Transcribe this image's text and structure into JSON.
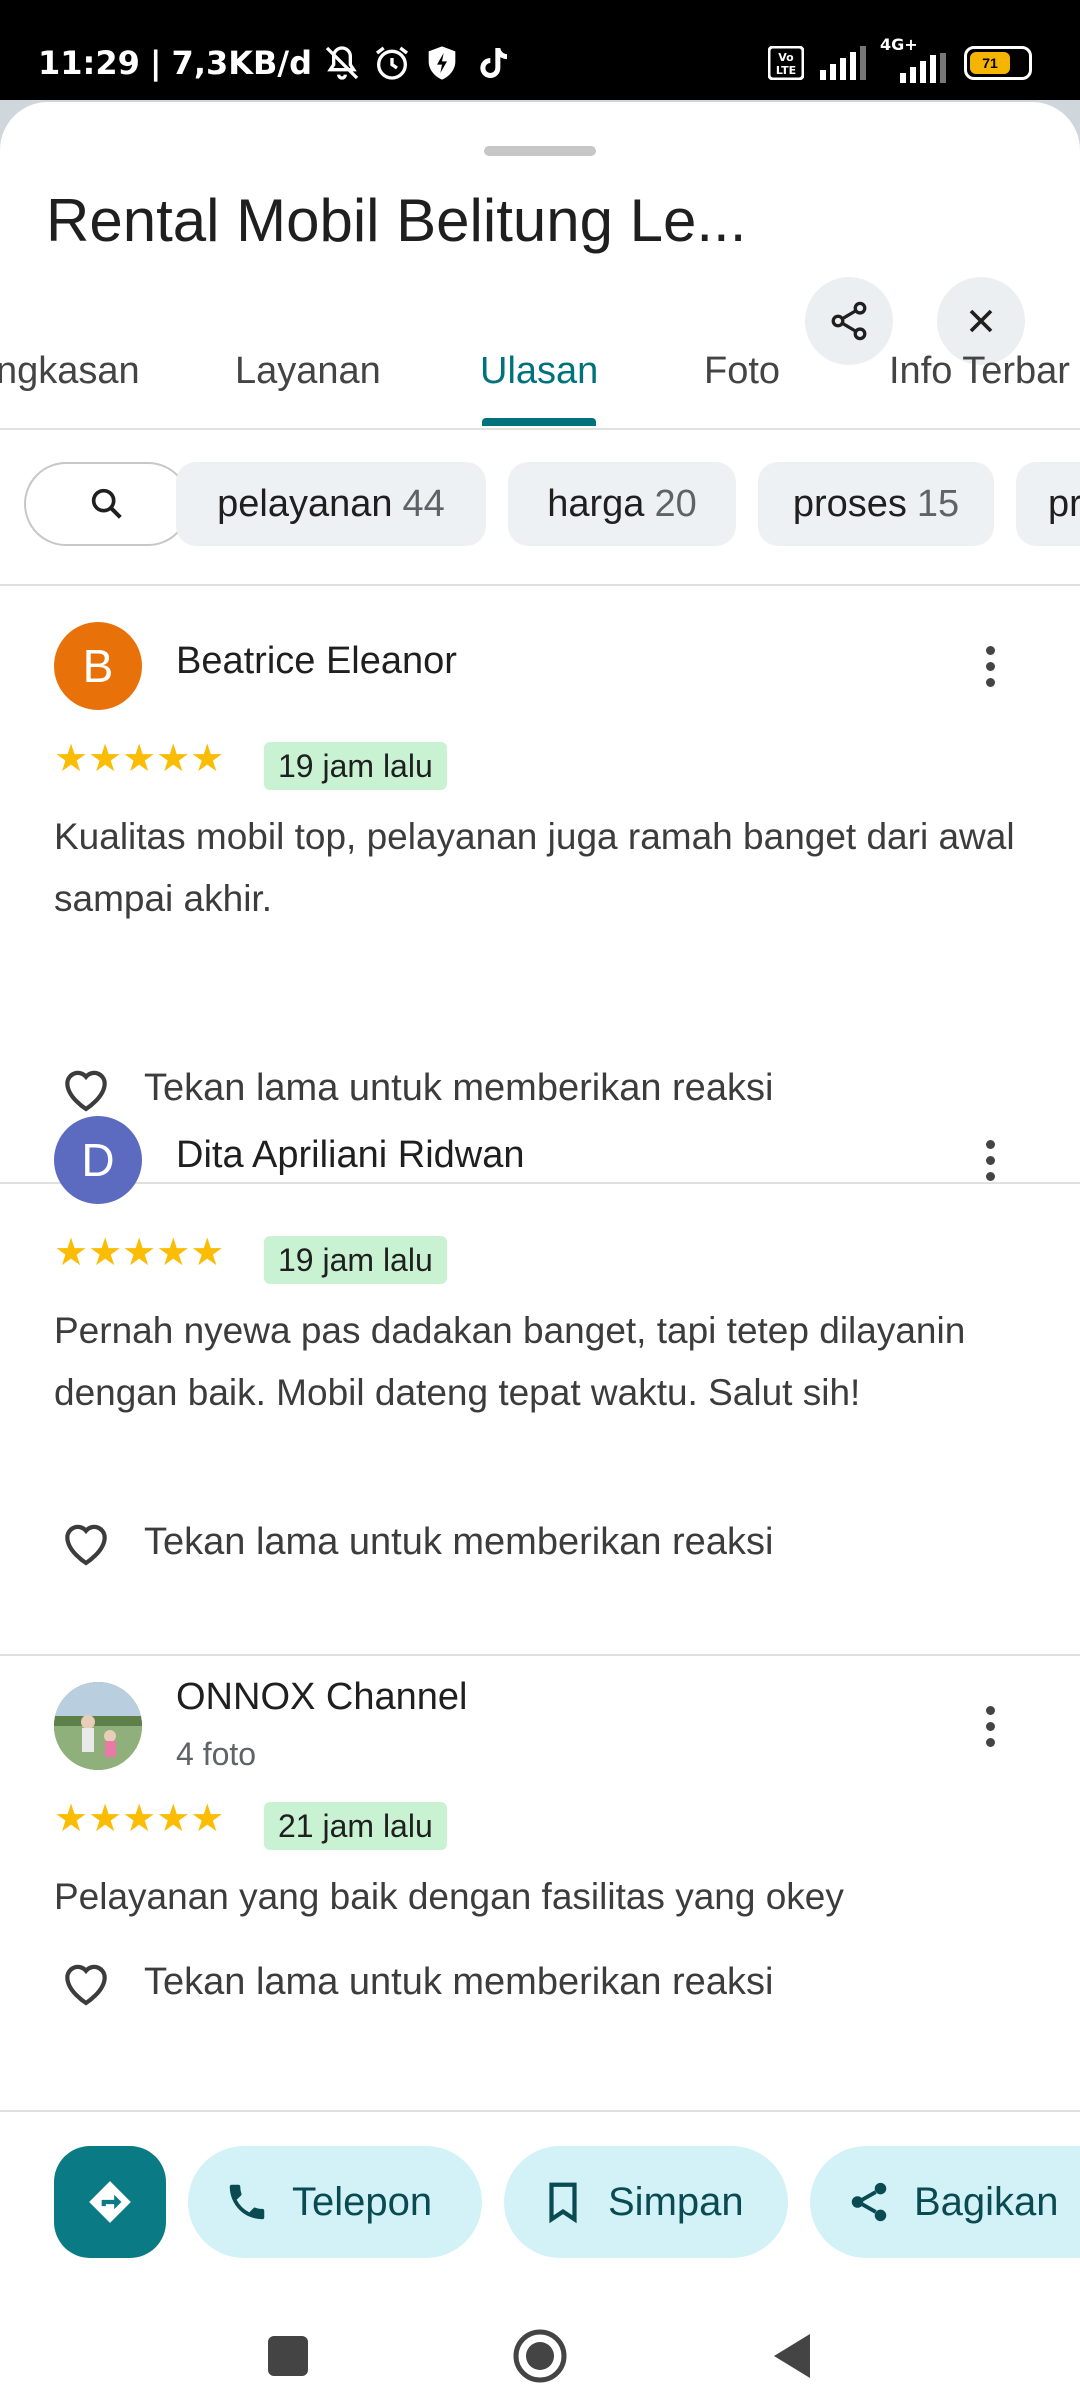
{
  "status_bar": {
    "time": "11:29",
    "data_speed": "7,3KB/d",
    "icons": [
      "mute-bell-icon",
      "alarm-icon",
      "shield-icon",
      "tiktok-icon"
    ],
    "network_icons": [
      "volte-icon",
      "signal-icon",
      "4g-signal-icon"
    ],
    "network_label": "4G+",
    "battery_level": "71"
  },
  "place": {
    "title": "Rental Mobil Belitung Le..."
  },
  "tabs": [
    {
      "label": "ngkasan"
    },
    {
      "label": "Layanan"
    },
    {
      "label": "Ulasan"
    },
    {
      "label": "Foto"
    },
    {
      "label": "Info Terbar"
    }
  ],
  "active_tab": "Ulasan",
  "chips": [
    {
      "label": "pelayanan",
      "count": "44"
    },
    {
      "label": "harga",
      "count": "20"
    },
    {
      "label": "proses",
      "count": "15"
    },
    {
      "label": "pr",
      "count": ""
    }
  ],
  "reviews": [
    {
      "initial": "B",
      "avatar_color": "#e8710a",
      "name": "Beatrice Eleanor",
      "sub": "",
      "stars": "★★★★★",
      "rating": 5,
      "time": "19 jam lalu",
      "text": "Kualitas mobil top, pelayanan juga ramah banget dari awal sampai akhir.",
      "reaction": "Tekan lama untuk memberikan reaksi"
    },
    {
      "initial": "D",
      "avatar_color": "#5c6bc0",
      "name": "Dita Apriliani Ridwan",
      "sub": "",
      "stars": "★★★★★",
      "rating": 5,
      "time": "19 jam lalu",
      "text": "Pernah nyewa pas dadakan banget, tapi tetep dilayanin dengan baik. Mobil dateng tepat waktu. Salut sih!",
      "reaction": "Tekan lama untuk memberikan reaksi"
    },
    {
      "initial": "",
      "avatar_color": "#6b8f5a",
      "name": "ONNOX Channel",
      "sub": "4 foto",
      "stars": "★★★★★",
      "rating": 5,
      "time": "21 jam lalu",
      "text": "Pelayanan yang baik dengan fasilitas yang okey",
      "reaction": "Tekan lama untuk memberikan reaksi"
    }
  ],
  "actions": {
    "call": "Telepon",
    "save": "Simpan",
    "share": "Bagikan"
  },
  "colors": {
    "accent": "#00727d",
    "star": "#fbbc04",
    "badge_bg": "#c9f2d3",
    "pill_bg": "#d2f2f7"
  }
}
